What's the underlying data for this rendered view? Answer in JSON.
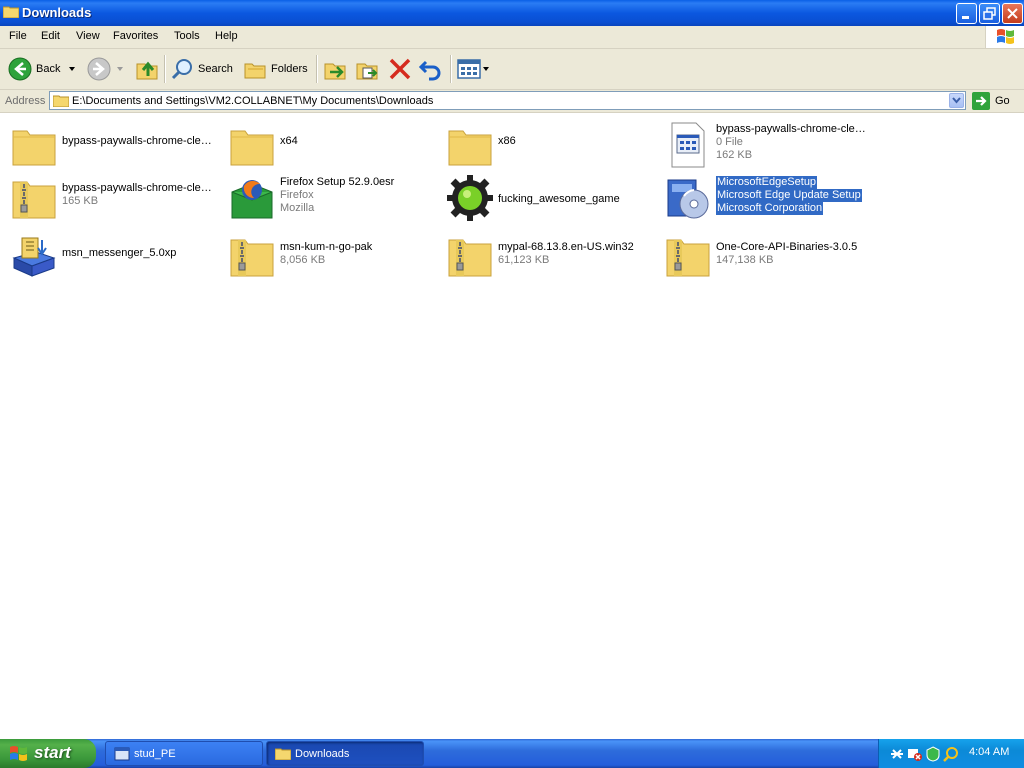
{
  "window": {
    "title": "Downloads",
    "controls": [
      "minimize-icon",
      "maximize-icon",
      "close-icon"
    ]
  },
  "menu": [
    "File",
    "Edit",
    "View",
    "Favorites",
    "Tools",
    "Help"
  ],
  "toolbar": {
    "back_label": "Back",
    "search_label": "Search",
    "folders_label": "Folders"
  },
  "address": {
    "label": "Address",
    "path": "E:\\Documents and Settings\\VM2.COLLABNET\\My Documents\\Downloads",
    "go_label": "Go"
  },
  "files": [
    {
      "name": "bypass-paywalls-chrome-clea...",
      "line2": "",
      "line3": "",
      "icon": "folder-icon"
    },
    {
      "name": "x64",
      "line2": "",
      "line3": "",
      "icon": "folder-icon"
    },
    {
      "name": "x86",
      "line2": "",
      "line3": "",
      "icon": "folder-icon"
    },
    {
      "name": "bypass-paywalls-chrome-clea...",
      "line2": "0 File",
      "line3": "162 KB",
      "icon": "file-icon"
    },
    {
      "name": "bypass-paywalls-chrome-clea...",
      "line2": "165 KB",
      "line3": "",
      "icon": "zip-folder-icon"
    },
    {
      "name": "Firefox Setup 52.9.0esr",
      "line2": "Firefox",
      "line3": "Mozilla",
      "icon": "firefox-installer-icon"
    },
    {
      "name": "fucking_awesome_game",
      "line2": "",
      "line3": "",
      "icon": "gear-icon"
    },
    {
      "name": "MicrosoftEdgeSetup",
      "line2": "Microsoft Edge Update Setup",
      "line3": "Microsoft Corporation",
      "icon": "setup-cd-icon",
      "selected": true
    },
    {
      "name": "msn_messenger_5.0xp",
      "line2": "",
      "line3": "",
      "icon": "msi-installer-icon"
    },
    {
      "name": "msn-kum-n-go-pak",
      "line2": "8,056 KB",
      "line3": "",
      "icon": "zip-folder-icon"
    },
    {
      "name": "mypal-68.13.8.en-US.win32",
      "line2": "61,123 KB",
      "line3": "",
      "icon": "zip-folder-icon"
    },
    {
      "name": "One-Core-API-Binaries-3.0.5",
      "line2": "147,138 KB",
      "line3": "",
      "icon": "zip-folder-icon"
    }
  ],
  "taskbar": {
    "start_label": "start",
    "tasks": [
      {
        "label": "stud_PE",
        "active": false
      },
      {
        "label": "Downloads",
        "active": true
      }
    ],
    "clock": "4:04 AM"
  },
  "colors": {
    "titlebar": "#0a58e0",
    "selection": "#316ac5",
    "chrome": "#ece9d8",
    "taskbar": "#245edb",
    "start": "#3a973a"
  }
}
